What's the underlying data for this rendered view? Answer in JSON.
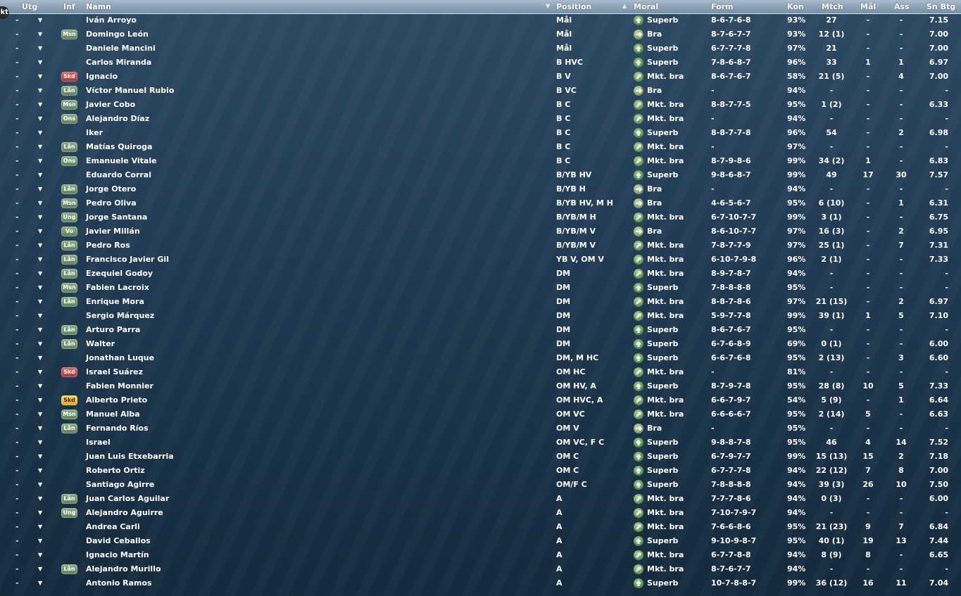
{
  "corner_label": "kt",
  "header": {
    "utg": "Utg",
    "inf": "Inf",
    "namn": "Namn",
    "position": "Position",
    "moral": "Moral",
    "form": "Form",
    "kon": "Kon",
    "mtch": "Mtch",
    "mal": "Mål",
    "ass": "Ass",
    "snbtg": "Sn Btg"
  },
  "rows": [
    {
      "name": "Iván Arroyo",
      "inf": "",
      "pos": "Mål",
      "moral": "Superb",
      "form": "8-6-7-6-8",
      "kon": "93%",
      "mtch": "27",
      "mal": "-",
      "ass": "-",
      "snbtg": "7.15"
    },
    {
      "name": "Domingo León",
      "inf": "Msn",
      "pos": "Mål",
      "moral": "Bra",
      "form": "8-7-6-7-7",
      "kon": "93%",
      "mtch": "12 (1)",
      "mal": "-",
      "ass": "-",
      "snbtg": "7.00"
    },
    {
      "name": "Daniele Mancini",
      "inf": "",
      "pos": "Mål",
      "moral": "Superb",
      "form": "6-7-7-7-8",
      "kon": "97%",
      "mtch": "21",
      "mal": "-",
      "ass": "-",
      "snbtg": "7.00"
    },
    {
      "name": "Carlos Miranda",
      "inf": "",
      "pos": "B HVC",
      "moral": "Superb",
      "form": "7-8-6-8-7",
      "kon": "96%",
      "mtch": "33",
      "mal": "1",
      "ass": "1",
      "snbtg": "6.97"
    },
    {
      "name": "Ignacio",
      "inf": "Skd",
      "pos": "B V",
      "moral": "Mkt. bra",
      "form": "8-6-7-6-7",
      "kon": "58%",
      "mtch": "21 (5)",
      "mal": "-",
      "ass": "4",
      "snbtg": "7.00"
    },
    {
      "name": "Víctor Manuel Rubio",
      "inf": "Lån",
      "pos": "B VC",
      "moral": "Bra",
      "form": "-",
      "kon": "94%",
      "mtch": "-",
      "mal": "-",
      "ass": "-",
      "snbtg": "-"
    },
    {
      "name": "Javier Cobo",
      "inf": "Msn",
      "pos": "B C",
      "moral": "Mkt. bra",
      "form": "8-8-7-7-5",
      "kon": "95%",
      "mtch": "1 (2)",
      "mal": "-",
      "ass": "-",
      "snbtg": "6.33"
    },
    {
      "name": "Alejandro Díaz",
      "inf": "Ons",
      "pos": "B C",
      "moral": "Mkt. bra",
      "form": "-",
      "kon": "94%",
      "mtch": "-",
      "mal": "-",
      "ass": "-",
      "snbtg": "-"
    },
    {
      "name": "Iker",
      "inf": "",
      "pos": "B C",
      "moral": "Superb",
      "form": "8-8-7-7-8",
      "kon": "96%",
      "mtch": "54",
      "mal": "-",
      "ass": "2",
      "snbtg": "6.98"
    },
    {
      "name": "Matías Quiroga",
      "inf": "Lån",
      "pos": "B C",
      "moral": "Mkt. bra",
      "form": "-",
      "kon": "97%",
      "mtch": "-",
      "mal": "-",
      "ass": "-",
      "snbtg": "-"
    },
    {
      "name": "Emanuele Vitale",
      "inf": "Ons",
      "pos": "B C",
      "moral": "Mkt. bra",
      "form": "8-7-9-8-6",
      "kon": "99%",
      "mtch": "34 (2)",
      "mal": "1",
      "ass": "-",
      "snbtg": "6.83"
    },
    {
      "name": "Eduardo Corral",
      "inf": "",
      "pos": "B/YB HV",
      "moral": "Superb",
      "form": "9-8-6-8-7",
      "kon": "99%",
      "mtch": "49",
      "mal": "17",
      "ass": "30",
      "snbtg": "7.57"
    },
    {
      "name": "Jorge Otero",
      "inf": "Lån",
      "pos": "B/YB H",
      "moral": "Bra",
      "form": "-",
      "kon": "94%",
      "mtch": "-",
      "mal": "-",
      "ass": "-",
      "snbtg": "-"
    },
    {
      "name": "Pedro Oliva",
      "inf": "Msn",
      "pos": "B/YB HV, M H",
      "moral": "Bra",
      "form": "4-6-5-6-7",
      "kon": "95%",
      "mtch": "6 (10)",
      "mal": "-",
      "ass": "1",
      "snbtg": "6.31"
    },
    {
      "name": "Jorge Santana",
      "inf": "Ung",
      "pos": "B/YB/M H",
      "moral": "Mkt. bra",
      "form": "6-7-10-7-7",
      "kon": "99%",
      "mtch": "3 (1)",
      "mal": "-",
      "ass": "-",
      "snbtg": "6.75"
    },
    {
      "name": "Javier Millán",
      "inf": "Vo",
      "pos": "B/YB/M V",
      "moral": "Bra",
      "form": "8-6-10-7-7",
      "kon": "97%",
      "mtch": "16 (3)",
      "mal": "-",
      "ass": "2",
      "snbtg": "6.95"
    },
    {
      "name": "Pedro Ros",
      "inf": "Lån",
      "pos": "B/YB/M V",
      "moral": "Mkt. bra",
      "form": "7-8-7-7-9",
      "kon": "97%",
      "mtch": "25 (1)",
      "mal": "-",
      "ass": "7",
      "snbtg": "7.31"
    },
    {
      "name": "Francisco Javier Gil",
      "inf": "Lån",
      "pos": "YB V, OM V",
      "moral": "Mkt. bra",
      "form": "6-10-7-9-8",
      "kon": "96%",
      "mtch": "2 (1)",
      "mal": "-",
      "ass": "-",
      "snbtg": "7.33"
    },
    {
      "name": "Ezequiel Godoy",
      "inf": "Lån",
      "pos": "DM",
      "moral": "Mkt. bra",
      "form": "8-9-7-8-7",
      "kon": "94%",
      "mtch": "-",
      "mal": "-",
      "ass": "-",
      "snbtg": "-"
    },
    {
      "name": "Fabien Lacroix",
      "inf": "Msn",
      "pos": "DM",
      "moral": "Superb",
      "form": "7-8-8-8-8",
      "kon": "95%",
      "mtch": "-",
      "mal": "-",
      "ass": "-",
      "snbtg": "-"
    },
    {
      "name": "Enrique Mora",
      "inf": "Lån",
      "pos": "DM",
      "moral": "Mkt. bra",
      "form": "8-8-7-8-6",
      "kon": "97%",
      "mtch": "21 (15)",
      "mal": "-",
      "ass": "2",
      "snbtg": "6.97"
    },
    {
      "name": "Sergio Márquez",
      "inf": "",
      "pos": "DM",
      "moral": "Mkt. bra",
      "form": "5-9-7-7-8",
      "kon": "99%",
      "mtch": "39 (1)",
      "mal": "1",
      "ass": "5",
      "snbtg": "7.10"
    },
    {
      "name": "Arturo Parra",
      "inf": "Lån",
      "pos": "DM",
      "moral": "Superb",
      "form": "8-6-7-6-7",
      "kon": "95%",
      "mtch": "-",
      "mal": "-",
      "ass": "-",
      "snbtg": "-"
    },
    {
      "name": "Walter",
      "inf": "Lån",
      "pos": "DM",
      "moral": "Superb",
      "form": "6-7-6-8-9",
      "kon": "69%",
      "mtch": "0 (1)",
      "mal": "-",
      "ass": "-",
      "snbtg": "6.00"
    },
    {
      "name": "Jonathan Luque",
      "inf": "",
      "pos": "DM, M HC",
      "moral": "Superb",
      "form": "6-6-7-6-8",
      "kon": "95%",
      "mtch": "2 (13)",
      "mal": "-",
      "ass": "3",
      "snbtg": "6.60"
    },
    {
      "name": "Israel Suárez",
      "inf": "Skd",
      "pos": "OM HC",
      "moral": "Mkt. bra",
      "form": "-",
      "kon": "81%",
      "mtch": "-",
      "mal": "-",
      "ass": "-",
      "snbtg": "-"
    },
    {
      "name": "Fabien Monnier",
      "inf": "",
      "pos": "OM HV, A",
      "moral": "Superb",
      "form": "8-7-9-7-8",
      "kon": "95%",
      "mtch": "28 (8)",
      "mal": "10",
      "ass": "5",
      "snbtg": "7.33"
    },
    {
      "name": "Alberto Prieto",
      "inf": "Skd",
      "infColor": "yellow",
      "pos": "OM HVC, A",
      "moral": "Mkt. bra",
      "form": "6-6-7-9-7",
      "kon": "54%",
      "mtch": "5 (9)",
      "mal": "-",
      "ass": "1",
      "snbtg": "6.64"
    },
    {
      "name": "Manuel Alba",
      "inf": "Msn",
      "pos": "OM VC",
      "moral": "Mkt. bra",
      "form": "6-6-6-6-7",
      "kon": "95%",
      "mtch": "2 (14)",
      "mal": "5",
      "ass": "-",
      "snbtg": "6.63"
    },
    {
      "name": "Fernando Ríos",
      "inf": "Lån",
      "pos": "OM V",
      "moral": "Bra",
      "form": "-",
      "kon": "95%",
      "mtch": "-",
      "mal": "-",
      "ass": "-",
      "snbtg": "-"
    },
    {
      "name": "Israel",
      "inf": "",
      "pos": "OM VC, F C",
      "moral": "Superb",
      "form": "9-8-8-7-8",
      "kon": "95%",
      "mtch": "46",
      "mal": "4",
      "ass": "14",
      "snbtg": "7.52"
    },
    {
      "name": "Juan Luis Etxebarria",
      "inf": "",
      "pos": "OM C",
      "moral": "Superb",
      "form": "6-7-9-7-7",
      "kon": "99%",
      "mtch": "15 (13)",
      "mal": "15",
      "ass": "2",
      "snbtg": "7.18"
    },
    {
      "name": "Roberto Ortiz",
      "inf": "",
      "pos": "OM C",
      "moral": "Superb",
      "form": "6-7-7-7-8",
      "kon": "94%",
      "mtch": "22 (12)",
      "mal": "7",
      "ass": "8",
      "snbtg": "7.00"
    },
    {
      "name": "Santiago Agirre",
      "inf": "",
      "pos": "OM/F C",
      "moral": "Superb",
      "form": "7-8-8-8-8",
      "kon": "94%",
      "mtch": "39 (3)",
      "mal": "26",
      "ass": "10",
      "snbtg": "7.50"
    },
    {
      "name": "Juan Carlos Aguilar",
      "inf": "Lån",
      "pos": "A",
      "moral": "Mkt. bra",
      "form": "7-7-7-8-6",
      "kon": "94%",
      "mtch": "0 (3)",
      "mal": "-",
      "ass": "-",
      "snbtg": "6.00"
    },
    {
      "name": "Alejandro Aguirre",
      "inf": "Ung",
      "pos": "A",
      "moral": "Mkt. bra",
      "form": "7-10-7-9-7",
      "kon": "94%",
      "mtch": "-",
      "mal": "-",
      "ass": "-",
      "snbtg": "-"
    },
    {
      "name": "Andrea Carli",
      "inf": "",
      "pos": "A",
      "moral": "Mkt. bra",
      "form": "7-6-6-8-6",
      "kon": "95%",
      "mtch": "21 (23)",
      "mal": "9",
      "ass": "7",
      "snbtg": "6.84"
    },
    {
      "name": "David Ceballos",
      "inf": "",
      "pos": "A",
      "moral": "Superb",
      "form": "9-10-9-8-7",
      "kon": "95%",
      "mtch": "40 (1)",
      "mal": "19",
      "ass": "13",
      "snbtg": "7.44"
    },
    {
      "name": "Ignacio Martín",
      "inf": "",
      "pos": "A",
      "moral": "Mkt. bra",
      "form": "6-7-7-8-8",
      "kon": "94%",
      "mtch": "8 (9)",
      "mal": "8",
      "ass": "-",
      "snbtg": "6.65"
    },
    {
      "name": "Alejandro Murillo",
      "inf": "Lån",
      "pos": "A",
      "moral": "Mkt. bra",
      "form": "8-7-6-7-7",
      "kon": "94%",
      "mtch": "-",
      "mal": "-",
      "ass": "-",
      "snbtg": "-"
    },
    {
      "name": "Antonio Ramos",
      "inf": "",
      "pos": "A",
      "moral": "Superb",
      "form": "10-7-8-8-7",
      "kon": "99%",
      "mtch": "36 (12)",
      "mal": "16",
      "ass": "11",
      "snbtg": "7.04"
    }
  ],
  "row_dash": "-",
  "colors": {
    "header": "#8ea5b8",
    "background": "#1f3a52",
    "badge_green": "#6f9169",
    "badge_red": "#b84545",
    "badge_yellow": "#f0b93a",
    "moral_icon": "#4c8a44"
  }
}
